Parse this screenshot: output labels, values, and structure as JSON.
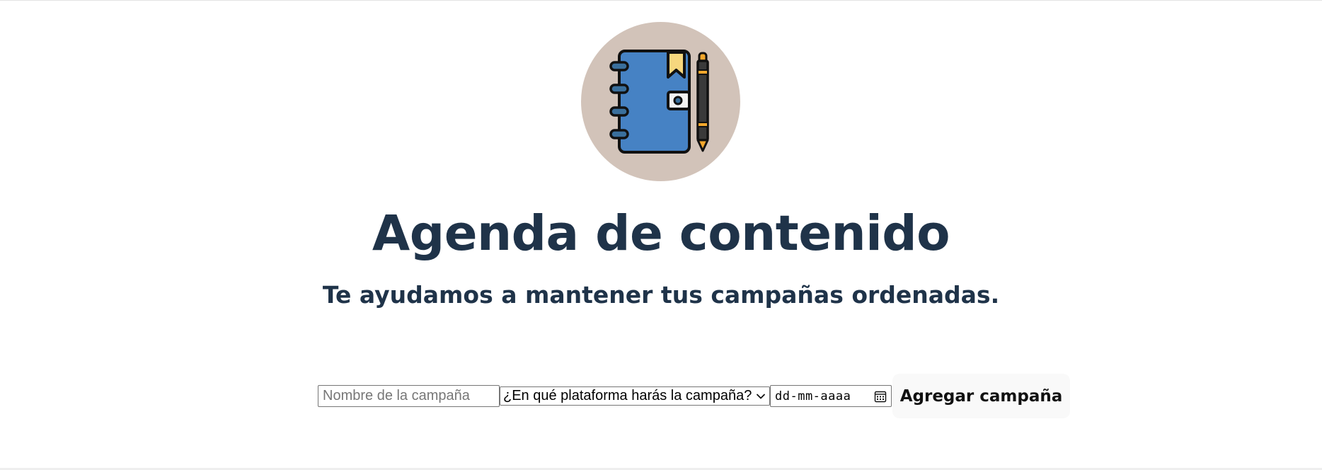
{
  "header": {
    "logo_icon": "notebook-and-pen-icon",
    "title": "Agenda de contenido",
    "subtitle": "Te ayudamos a mantener tus campañas ordenadas."
  },
  "form": {
    "name_placeholder": "Nombre de la campaña",
    "name_value": "",
    "platform_selected": "¿En qué plataforma harás la campaña?",
    "date_placeholder": "dd-mm-aaaa",
    "add_button_label": "Agregar campaña"
  },
  "colors": {
    "heading": "#1f3349",
    "logo_background": "#d2c3b9",
    "notebook_blue": "#4682c4",
    "bookmark_yellow": "#f6d77e",
    "pen_dark": "#3a3a3a",
    "pen_accent": "#f2a72c",
    "button_background": "#f9f9f9"
  }
}
